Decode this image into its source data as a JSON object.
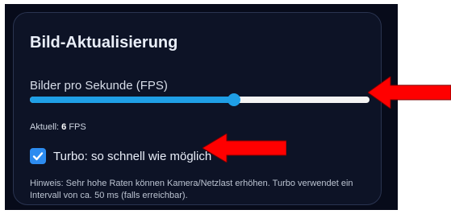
{
  "card": {
    "title": "Bild-Aktualisierung",
    "fps_slider": {
      "label": "Bilder pro Sekunde (FPS)",
      "level_fraction": 0.6
    },
    "current": {
      "prefix": "Aktuell:",
      "value": "6",
      "unit": "FPS"
    },
    "turbo": {
      "checked": true,
      "label": "Turbo: so schnell wie möglich"
    },
    "hint": "Hinweis: Sehr hohe Raten können Kamera/Netzlast erhöhen. Turbo verwendet ein Intervall von ca. 50 ms (falls erreichbar)."
  },
  "colors": {
    "background": "#070b1a",
    "card": "#0d1326",
    "accent": "#1f9fe6",
    "checkbox": "#2d8cf0",
    "annotation_arrow": "#ff0000"
  },
  "icons": {
    "checkbox": "checkmark-icon",
    "annotations": [
      "red-arrow-icon",
      "red-arrow-icon"
    ]
  }
}
